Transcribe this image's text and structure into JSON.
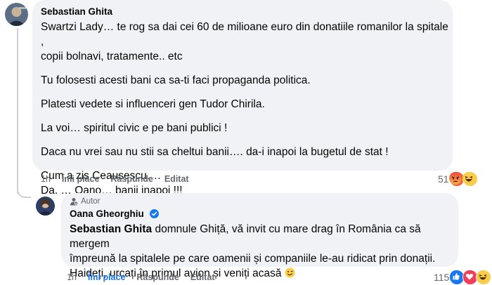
{
  "comment": {
    "author": "Sebastian Ghita",
    "paragraphs": [
      "Swartzi Lady… te rog sa dai cei 60 de milioane euro din donatiile romanilor la spitale ,",
      "copii bolnavi, tratamente.. etc",
      "Tu folosesti acesti bani ca sa-ti faci propaganda politica.",
      "Platesti vedete si influenceri gen Tudor Chirila.",
      "La voi… spiritul civic e pe bani publici !",
      "Daca nu vrei sau nu stii sa cheltui banii…. da-i inapoi la bugetul de stat !",
      "Cum a zis Ceausescu….",
      "Da. … Oano… banii inapoi !!!"
    ],
    "time": "1h",
    "like_label": "Îmi place",
    "reply_label": "Răspunde",
    "edited_label": "Editat",
    "reaction_count": "51"
  },
  "reply": {
    "badge": "Autor",
    "author": "Oana Gheorghiu",
    "mention": "Sebastian Ghita",
    "lines": [
      " domnule Ghiță, vă invit cu mare drag în România ca să mergem",
      "împreună la spitalele pe care oamenii și companiile le-au ridicat prin donații.",
      "Haideți, urcați în primul avion și veniți acasă "
    ],
    "emoji": "winking-face-emoji",
    "time": "1h",
    "like_label": "Îmi place",
    "reply_label": "Răspunde",
    "edited_label": "Editat",
    "reaction_count": "115"
  },
  "colors": {
    "bubble": "#f0f2f5",
    "link_blue": "#1877f2",
    "muted": "#65676b",
    "angry": "#f2603d",
    "haha": "#fbcd4a"
  }
}
